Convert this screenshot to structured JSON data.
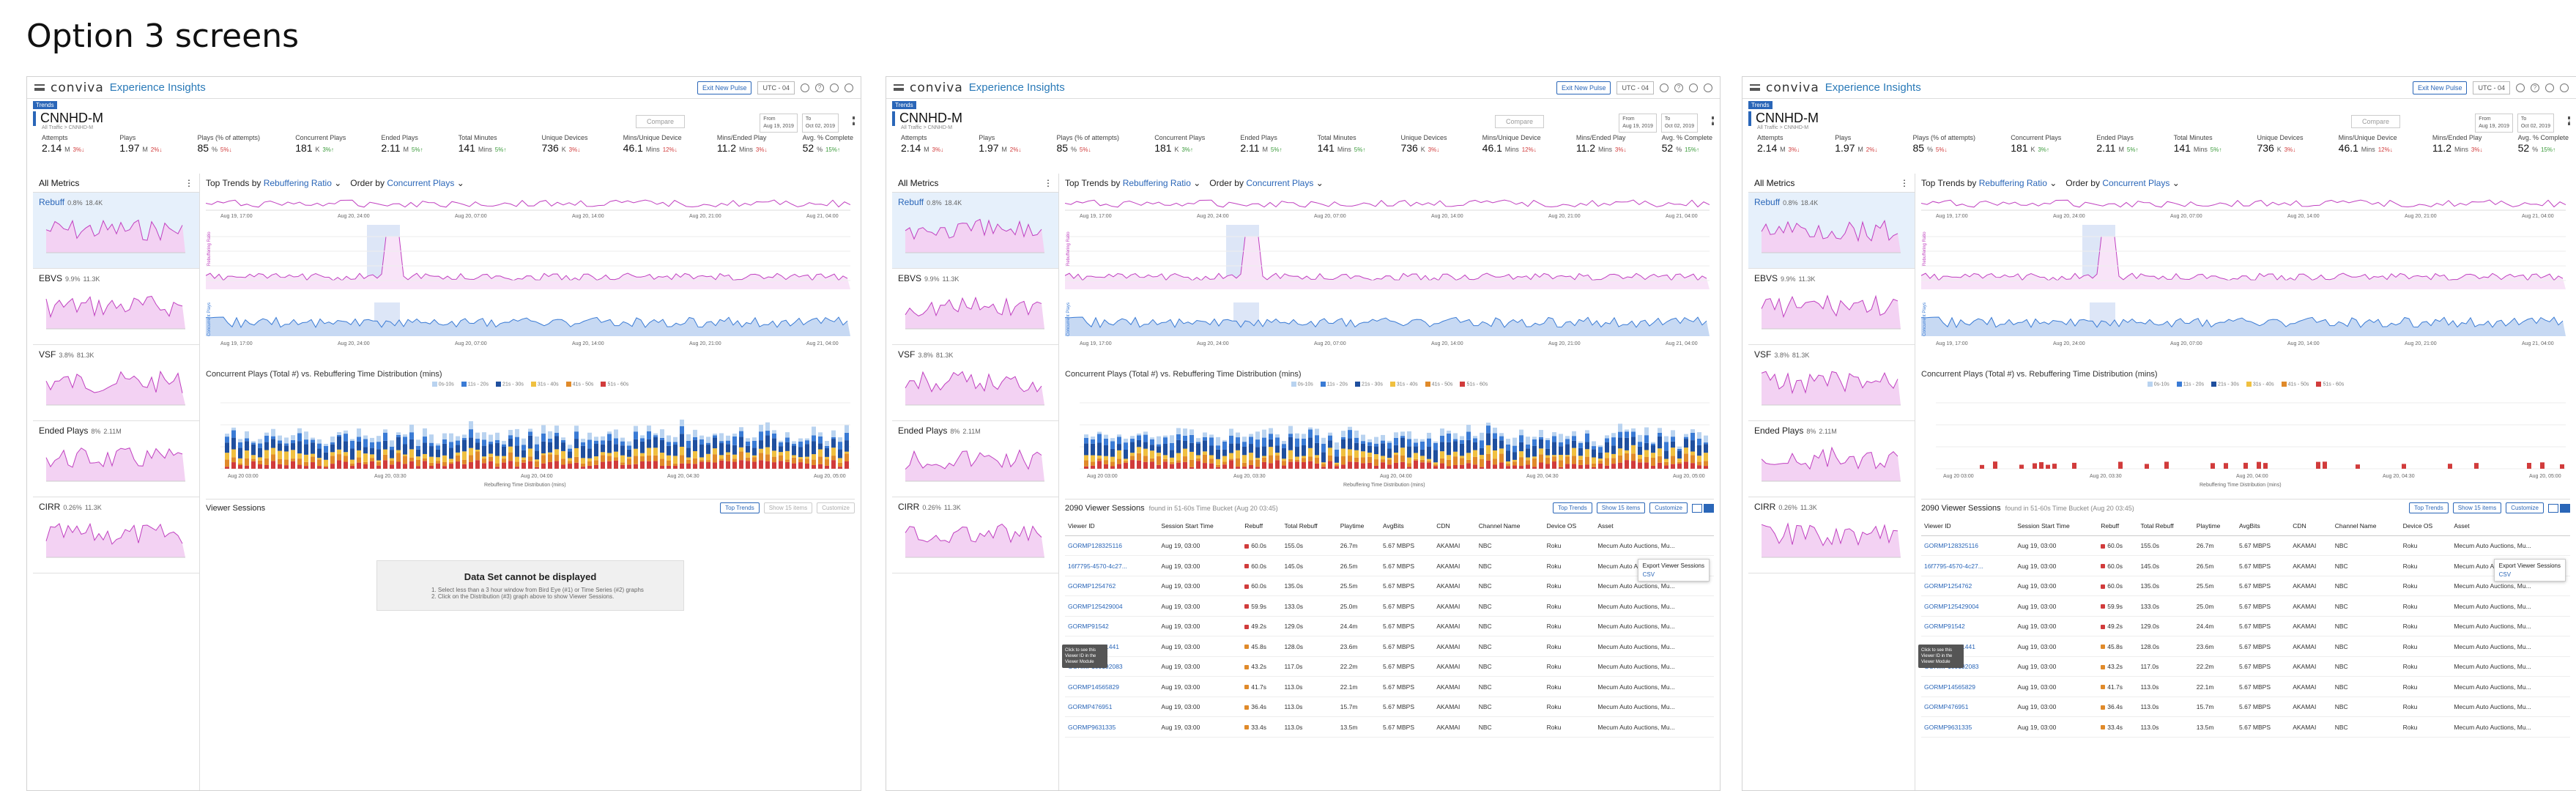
{
  "heading": "Option 3 screens",
  "app": {
    "logo": "conviva",
    "product": "Experience Insights",
    "exit_label": "Exit New Pulse",
    "utc": "UTC - 04"
  },
  "page": {
    "tag": "Trends",
    "title": "CNNHD-M",
    "subtitle": "All Traffic > CNNHD-M",
    "compare": "Compare",
    "date_from": "Aug 19, 2019",
    "date_to": "Oct 02, 2019",
    "from_label": "From",
    "to_label": "To"
  },
  "metrics": [
    {
      "label": "Attempts",
      "value": "2.14",
      "unit": "M",
      "delta": "3%",
      "dir": "down"
    },
    {
      "label": "Plays",
      "value": "1.97",
      "unit": "M",
      "delta": "2%",
      "dir": "down"
    },
    {
      "label": "Plays (% of attempts)",
      "value": "85",
      "unit": "%",
      "delta": "5%",
      "dir": "down"
    },
    {
      "label": "Concurrent Plays",
      "value": "181",
      "unit": "K",
      "delta": "3%",
      "dir": "up"
    },
    {
      "label": "Ended Plays",
      "value": "2.11",
      "unit": "M",
      "delta": "5%",
      "dir": "up"
    },
    {
      "label": "Total Minutes",
      "value": "141",
      "unit": "Mins",
      "delta": "5%",
      "dir": "up"
    },
    {
      "label": "Unique Devices",
      "value": "736",
      "unit": "K",
      "delta": "3%",
      "dir": "down"
    },
    {
      "label": "Mins/Unique Device",
      "value": "46.1",
      "unit": "Mins",
      "delta": "12%",
      "dir": "down"
    },
    {
      "label": "Mins/Ended Play",
      "value": "11.2",
      "unit": "Mins",
      "delta": "3%",
      "dir": "down"
    },
    {
      "label": "Avg. % Complete",
      "value": "52",
      "unit": "%",
      "delta": "15%",
      "dir": "up"
    }
  ],
  "left": {
    "title": "All Metrics",
    "cards": [
      {
        "name": "Rebuff",
        "pct": "0.8%",
        "count": "18.4K"
      },
      {
        "name": "EBVS",
        "pct": "9.9%",
        "count": "11.3K"
      },
      {
        "name": "VSF",
        "pct": "3.8%",
        "count": "81.3K"
      },
      {
        "name": "Ended Plays",
        "pct": "8%",
        "count": "2.11M"
      },
      {
        "name": "CIRR",
        "pct": "0.26%",
        "count": "11.3K"
      }
    ]
  },
  "trends": {
    "label": "Top Trends by",
    "metric": "Rebuffering Ratio",
    "order_label": "Order by",
    "order": "Concurrent Plays",
    "ticks": [
      "Aug 19, 17:00",
      "Aug 20, 24:00",
      "Aug 20, 07:00",
      "Aug 20, 14:00",
      "Aug 20, 21:00",
      "Aug 21, 04:00"
    ],
    "y_label": "Rebuffering Ratio",
    "y_label2": "Concurrent Plays"
  },
  "dist": {
    "title": "Concurrent Plays (Total #) vs. Rebuffering Time Distribution (mins)",
    "legend": [
      "0s-10s",
      "11s - 20s",
      "21s - 30s",
      "31s - 40s",
      "41s - 50s",
      "51s - 60s"
    ],
    "xlabel": "Rebuffering Time Distribution (mins)",
    "ticks": [
      "Aug 20 03:00",
      "Aug 20, 03:30",
      "Aug 20, 04:00",
      "Aug 20, 04:30",
      "Aug 20, 05:00"
    ]
  },
  "viewer": {
    "title_empty": "Viewer Sessions",
    "count": "2090 Viewer Sessions",
    "found": "found in 51-60s Time Bucket (Aug 20 03:45)",
    "top_trends": "Top Trends",
    "show": "Show 15 items",
    "customize": "Customize",
    "export": "Export Viewer Sessions",
    "csv": "CSV",
    "empty_title": "Data Set cannot be displayed",
    "empty_lines": [
      "1. Select less than a 3 hour window from Bird Eye (#1) or Time Series (#2) graphs",
      "2. Click on the Distribution (#3) graph above to show Viewer Sessions."
    ],
    "tooltip": "Click to see this Viewer ID in the Viewer Module",
    "columns": [
      "Viewer ID",
      "Session Start Time",
      "Rebuff",
      "Total Rebuff",
      "Playtime",
      "AvgBits",
      "CDN",
      "Channel Name",
      "Device OS",
      "Asset"
    ],
    "rows": [
      [
        "GORMP128325116",
        "Aug 19, 03:00",
        "60.0s",
        "155.0s",
        "26.7m",
        "5.67 MBPS",
        "AKAMAI",
        "NBC",
        "Roku",
        "Mecum Auto Auctions, Mu..."
      ],
      [
        "16f7795-4570-4c27...",
        "Aug 19, 03:00",
        "60.0s",
        "145.0s",
        "26.5m",
        "5.67 MBPS",
        "AKAMAI",
        "NBC",
        "Roku",
        "Mecum Auto Auctions, Mu..."
      ],
      [
        "GORMP1254762",
        "Aug 19, 03:00",
        "60.0s",
        "135.0s",
        "25.5m",
        "5.67 MBPS",
        "AKAMAI",
        "NBC",
        "Roku",
        "Mecum Auto Auctions, Mu..."
      ],
      [
        "GORMP125429004",
        "Aug 19, 03:00",
        "59.9s",
        "133.0s",
        "25.0m",
        "5.67 MBPS",
        "AKAMAI",
        "NBC",
        "Roku",
        "Mecum Auto Auctions, Mu..."
      ],
      [
        "GORMP91542",
        "Aug 19, 03:00",
        "49.2s",
        "129.0s",
        "24.4m",
        "5.67 MBPS",
        "AKAMAI",
        "NBC",
        "Roku",
        "Mecum Auto Auctions, Mu..."
      ],
      [
        "GORMP12451441",
        "Aug 19, 03:00",
        "45.8s",
        "128.0s",
        "23.6m",
        "5.67 MBPS",
        "AKAMAI",
        "NBC",
        "Roku",
        "Mecum Auto Auctions, Mu..."
      ],
      [
        "GORMP109192083",
        "Aug 19, 03:00",
        "43.2s",
        "117.0s",
        "22.2m",
        "5.67 MBPS",
        "AKAMAI",
        "NBC",
        "Roku",
        "Mecum Auto Auctions, Mu..."
      ],
      [
        "GORMP14565829",
        "Aug 19, 03:00",
        "41.7s",
        "113.0s",
        "22.1m",
        "5.67 MBPS",
        "AKAMAI",
        "NBC",
        "Roku",
        "Mecum Auto Auctions, Mu..."
      ],
      [
        "GORMP476951",
        "Aug 19, 03:00",
        "36.4s",
        "113.0s",
        "15.7m",
        "5.67 MBPS",
        "AKAMAI",
        "NBC",
        "Roku",
        "Mecum Auto Auctions, Mu..."
      ],
      [
        "GORMP9631335",
        "Aug 19, 03:00",
        "33.4s",
        "113.0s",
        "13.5m",
        "5.67 MBPS",
        "AKAMAI",
        "NBC",
        "Roku",
        "Mecum Auto Auctions, Mu..."
      ]
    ]
  },
  "colors": {
    "accent": "#2a66b8",
    "magenta": "#c040c0",
    "blue": "#3a7bd5",
    "red": "#d13b3b"
  }
}
